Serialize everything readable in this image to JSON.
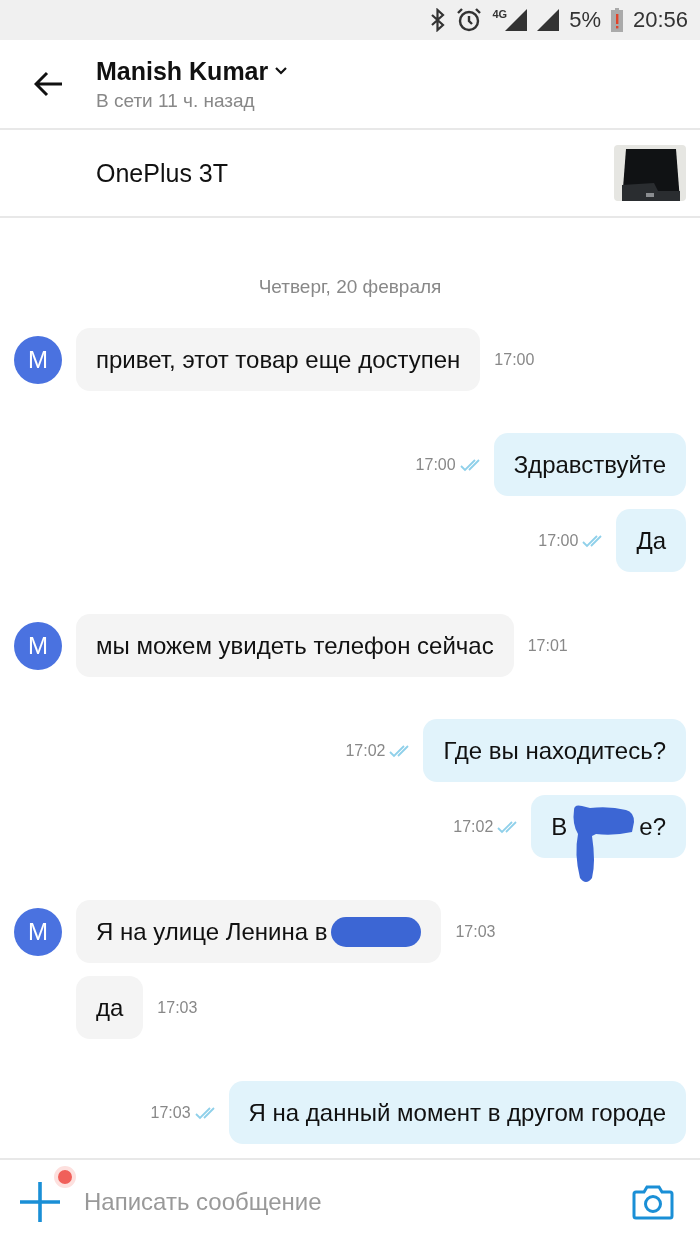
{
  "status_bar": {
    "network": "4G",
    "battery": "5%",
    "time": "20:56"
  },
  "header": {
    "name": "Manish Kumar",
    "status": "В сети 11 ч. назад"
  },
  "listing": {
    "title": "OnePlus 3T"
  },
  "date_divider": "Четверг, 20 февраля",
  "messages": [
    {
      "kind": "incoming",
      "avatar": "M",
      "text": "привет, этот товар еще доступен",
      "time": "17:00",
      "redacted": false
    },
    {
      "kind": "outgoing",
      "text": "Здравствуйте",
      "time": "17:00",
      "read": true,
      "redacted": false
    },
    {
      "kind": "outgoing",
      "text": "Да",
      "time": "17:00",
      "read": true,
      "redacted": false
    },
    {
      "kind": "incoming",
      "avatar": "M",
      "text": "мы можем увидеть телефон сейчас",
      "time": "17:01",
      "redacted": false
    },
    {
      "kind": "outgoing",
      "text": "Где вы находитесь?",
      "time": "17:02",
      "read": true,
      "redacted": false
    },
    {
      "kind": "outgoing",
      "text": "В",
      "text_after": "е?",
      "time": "17:02",
      "read": true,
      "redacted": true
    },
    {
      "kind": "incoming",
      "avatar": "M",
      "text": "Я на улице Ленина в",
      "time": "17:03",
      "redacted": true
    },
    {
      "kind": "incoming",
      "text": "да",
      "time": "17:03",
      "redacted": false
    },
    {
      "kind": "outgoing",
      "text": "Я на данный момент в другом городе",
      "time": "17:03",
      "read": true,
      "redacted": false
    }
  ],
  "composer": {
    "placeholder": "Написать сообщение",
    "attach_notification": true
  }
}
